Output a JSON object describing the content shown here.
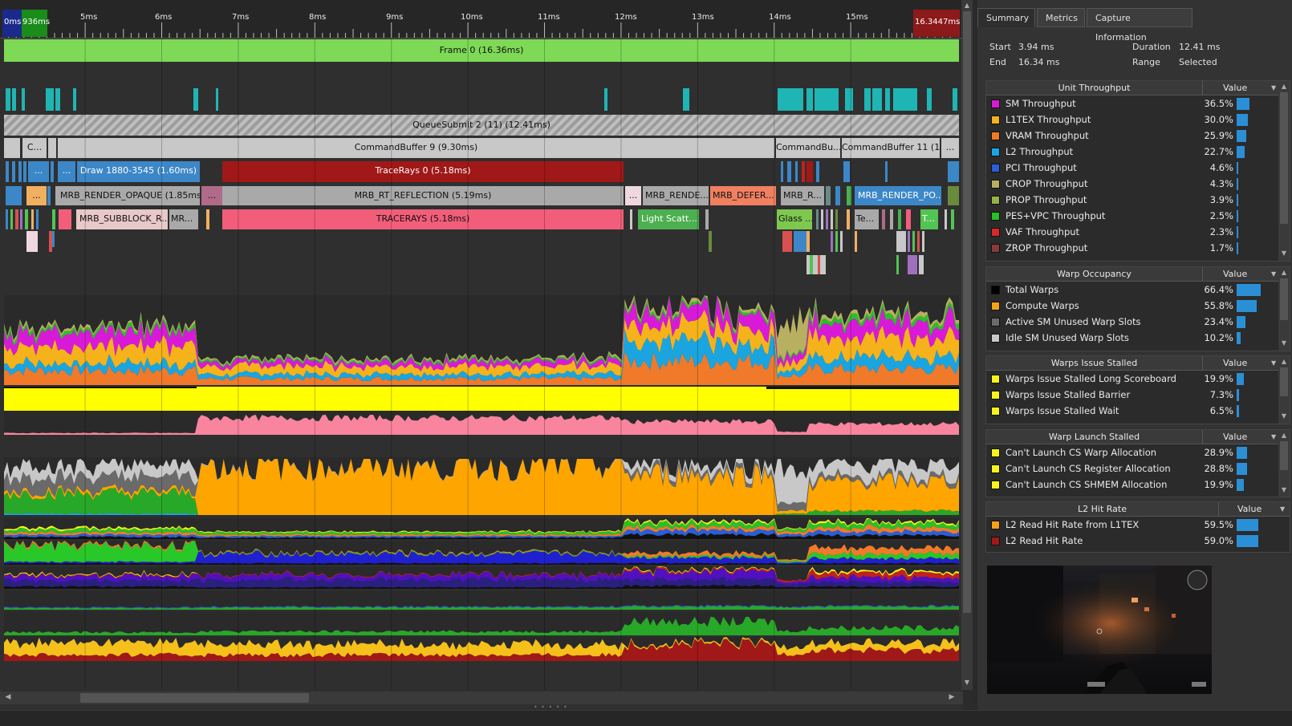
{
  "ruler": {
    "start_left": "0ms",
    "start_right": "936ms",
    "end": "16.3447ms",
    "ticks": [
      {
        "label": "5ms"
      },
      {
        "label": "6ms"
      },
      {
        "label": "7ms"
      },
      {
        "label": "8ms"
      },
      {
        "label": "9ms"
      },
      {
        "label": "10ms"
      },
      {
        "label": "11ms"
      },
      {
        "label": "12ms"
      },
      {
        "label": "13ms"
      },
      {
        "label": "14ms"
      },
      {
        "label": "15ms"
      }
    ]
  },
  "frame": {
    "label": "Frame 0 (16.36ms)"
  },
  "queue": {
    "label": "QueueSubmit 2 (11) (12.41ms)"
  },
  "command_buffers": [
    {
      "label": "",
      "color": "#c8c8c8"
    },
    {
      "label": "C...",
      "color": "#c8c8c8"
    },
    {
      "label": "",
      "color": "#c8c8c8"
    },
    {
      "label": "CommandBuffer 9 (9.30ms)",
      "color": "#c8c8c8"
    },
    {
      "label": "CommandBu...",
      "color": "#c8c8c8"
    },
    {
      "label": "CommandBuffer 11 (1...",
      "color": "#c8c8c8"
    },
    {
      "label": "...",
      "color": "#c8c8c8"
    }
  ],
  "draw_row": [
    {
      "label": "...",
      "color": "#3c87c8"
    },
    {
      "label": "...",
      "color": "#3c87c8"
    },
    {
      "label": "Draw 1880-3545 (1.60ms)",
      "color": "#3c87c8"
    },
    {
      "label": "TraceRays 0 (5.18ms)",
      "color": "#a01818"
    }
  ],
  "mrb_row": [
    {
      "label": "...",
      "color": "#f0b060"
    },
    {
      "label": "MRB_RENDER_OPAQUE (1.85ms)",
      "color": "#a9a9a9"
    },
    {
      "label": "...",
      "color": "#b06a8a"
    },
    {
      "label": "MRB_RT_REFLECTION (5.19ms)",
      "color": "#a9a9a9"
    },
    {
      "label": "...",
      "color": "#f0d8e0"
    },
    {
      "label": "MRB_RENDE...",
      "color": "#a9a9a9"
    },
    {
      "label": "MRB_DEFER...",
      "color": "#f08060"
    },
    {
      "label": "MRB_R...",
      "color": "#a9a9a9"
    },
    {
      "label": "MRB_RENDER_PO...",
      "color": "#3c87c8"
    }
  ],
  "sub_row": [
    {
      "label": "MRB_SUBBLOCK_R...",
      "color": "#e8c8c8"
    },
    {
      "label": "MR...",
      "color": "#a9a9a9"
    },
    {
      "label": "TRACERAYS (5.18ms)",
      "color": "#f25e7a"
    },
    {
      "label": "Light Scatt...",
      "color": "#4caf50"
    },
    {
      "label": "Glass ...",
      "color": "#7ec850"
    },
    {
      "label": "Te...",
      "color": "#a9a9a9"
    },
    {
      "label": "T...",
      "color": "#52c452"
    }
  ],
  "tabs": [
    {
      "label": "Summary",
      "active": true
    },
    {
      "label": "Metrics",
      "active": false
    },
    {
      "label": "Capture Information",
      "active": false
    }
  ],
  "summary": {
    "start_label": "Start",
    "start_value": "3.94 ms",
    "end_label": "End",
    "end_value": "16.34 ms",
    "duration_label": "Duration",
    "duration_value": "12.41 ms",
    "range_label": "Range",
    "range_value": "Selected"
  },
  "sections": [
    {
      "title": "Unit Throughput",
      "value_header": "Value",
      "rows": [
        {
          "name": "SM Throughput",
          "value": "36.5%",
          "pct": 36.5,
          "color": "#d81ad8"
        },
        {
          "name": "L1TEX Throughput",
          "value": "30.0%",
          "pct": 30.0,
          "color": "#f5b21a"
        },
        {
          "name": "VRAM Throughput",
          "value": "25.9%",
          "pct": 25.9,
          "color": "#f07a2a"
        },
        {
          "name": "L2 Throughput",
          "value": "22.7%",
          "pct": 22.7,
          "color": "#1aa5e0"
        },
        {
          "name": "PCI Throughput",
          "value": "4.6%",
          "pct": 4.6,
          "color": "#2a5ed8"
        },
        {
          "name": "CROP Throughput",
          "value": "4.3%",
          "pct": 4.3,
          "color": "#b8b060"
        },
        {
          "name": "PROP Throughput",
          "value": "3.9%",
          "pct": 3.9,
          "color": "#98b048"
        },
        {
          "name": "PES+VPC Throughput",
          "value": "2.5%",
          "pct": 2.5,
          "color": "#28c028"
        },
        {
          "name": "VAF Throughput",
          "value": "2.3%",
          "pct": 2.3,
          "color": "#d82828"
        },
        {
          "name": "ZROP Throughput",
          "value": "1.7%",
          "pct": 1.7,
          "color": "#8a3a3a"
        }
      ]
    },
    {
      "title": "Warp Occupancy",
      "value_header": "Value",
      "rows": [
        {
          "name": "Total Warps",
          "value": "66.4%",
          "pct": 66.4,
          "color": "#000000"
        },
        {
          "name": "Compute Warps",
          "value": "55.8%",
          "pct": 55.8,
          "color": "#f5a21a"
        },
        {
          "name": "Active SM Unused Warp Slots",
          "value": "23.4%",
          "pct": 23.4,
          "color": "#6a6a6a"
        },
        {
          "name": "Idle SM Unused Warp Slots",
          "value": "10.2%",
          "pct": 10.2,
          "color": "#c8c8c8"
        }
      ]
    },
    {
      "title": "Warps Issue Stalled",
      "value_header": "Value",
      "rows": [
        {
          "name": "Warps Issue Stalled Long Scoreboard",
          "value": "19.9%",
          "pct": 19.9,
          "color": "#f5f51a"
        },
        {
          "name": "Warps Issue Stalled Barrier",
          "value": "7.3%",
          "pct": 7.3,
          "color": "#f5f51a"
        },
        {
          "name": "Warps Issue Stalled Wait",
          "value": "6.5%",
          "pct": 6.5,
          "color": "#f5f51a"
        }
      ]
    },
    {
      "title": "Warp Launch Stalled",
      "value_header": "Value",
      "rows": [
        {
          "name": "Can't Launch CS Warp Allocation",
          "value": "28.9%",
          "pct": 28.9,
          "color": "#f5f51a"
        },
        {
          "name": "Can't Launch CS Register Allocation",
          "value": "28.8%",
          "pct": 28.8,
          "color": "#f5f51a"
        },
        {
          "name": "Can't Launch CS SHMEM Allocation",
          "value": "19.9%",
          "pct": 19.9,
          "color": "#f5f51a"
        }
      ]
    },
    {
      "title": "L2 Hit Rate",
      "value_header": "Value",
      "rows": [
        {
          "name": "L2 Read Hit Rate from L1TEX",
          "value": "59.5%",
          "pct": 59.5,
          "color": "#f5a21a"
        },
        {
          "name": "L2 Read Hit Rate",
          "value": "59.0%",
          "pct": 59.0,
          "color": "#a01818"
        }
      ]
    }
  ],
  "colors": {
    "accent": "#2b8fd6",
    "frame": "#7ed957",
    "occupancy_yellow": "#ffff00",
    "traceray_pink": "#f8849e",
    "compute_orange": "#ffa500"
  }
}
